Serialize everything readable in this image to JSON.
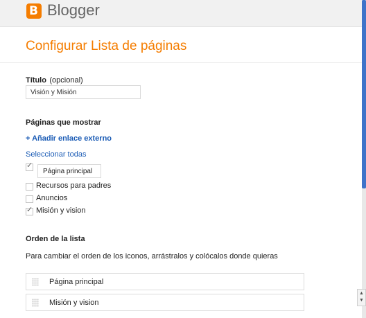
{
  "header": {
    "logo_letter": "B",
    "brand": "Blogger"
  },
  "dialog_title": "Configurar Lista de páginas",
  "title_field": {
    "label": "Título",
    "optional": "(opcional)",
    "value": "Visión y Misión"
  },
  "pages": {
    "label": "Páginas que mostrar",
    "add_external": "+ Añadir enlace externo",
    "select_all": "Seleccionar todas",
    "items": [
      {
        "label": "Página principal",
        "checked": true
      },
      {
        "label": "Recursos para padres",
        "checked": false
      },
      {
        "label": "Anuncios",
        "checked": false
      },
      {
        "label": "Misión y vision",
        "checked": true
      }
    ]
  },
  "order": {
    "label": "Orden de la lista",
    "description": "Para cambiar el orden de los iconos, arrástralos y colócalos donde quieras",
    "items": [
      "Página principal",
      "Misión y vision"
    ]
  },
  "colors": {
    "accent": "#f57d00",
    "link": "#1a5bb5",
    "scroll_thumb": "#3f73c9"
  }
}
